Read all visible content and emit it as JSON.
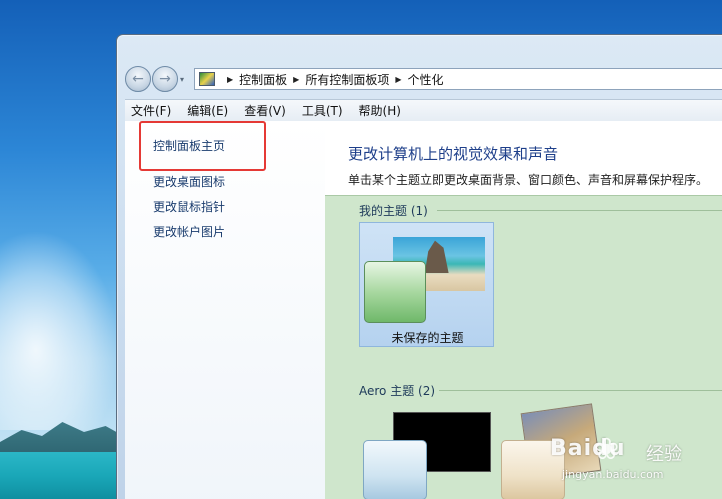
{
  "address_bar": {
    "crumbs": [
      "控制面板",
      "所有控制面板项",
      "个性化"
    ]
  },
  "menu": {
    "items": [
      "文件(F)",
      "编辑(E)",
      "查看(V)",
      "工具(T)",
      "帮助(H)"
    ]
  },
  "left_pane": {
    "links": [
      "控制面板主页",
      "更改桌面图标",
      "更改鼠标指针",
      "更改帐户图片"
    ]
  },
  "main": {
    "heading": "更改计算机上的视觉效果和声音",
    "subtext": "单击某个主题立即更改桌面背景、窗口颜色、声音和屏幕保护程序。",
    "my_themes_label": "我的主题 (1)",
    "my_theme_name": "未保存的主题",
    "aero_themes_label": "Aero 主题 (2)"
  },
  "watermark": {
    "brand": "Baidu",
    "brand_cn": "经验",
    "url": "jingyan.baidu.com"
  },
  "colors": {
    "highlight_box": "#e53935",
    "link": "#1a3c6e",
    "heading": "#1e3f8a",
    "themes_bg": "#cfe6cc"
  },
  "icons": [
    "back-arrow-icon",
    "forward-arrow-icon",
    "control-panel-icon",
    "paw-icon"
  ]
}
